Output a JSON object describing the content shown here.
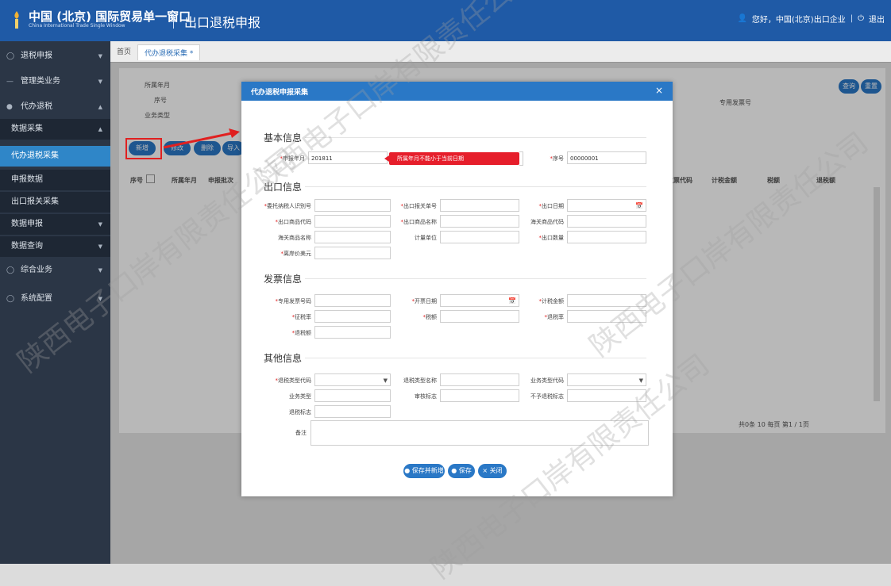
{
  "header": {
    "title": "中国 (北京) 国际贸易单一窗口",
    "subtitle": "China International Trade Single Window",
    "module": "出口退税申报",
    "user": "您好，中国(北京)出口企业",
    "logout": "退出"
  },
  "sidebar": {
    "items": [
      {
        "label": "退税申报"
      },
      {
        "label": "管理类业务"
      },
      {
        "label": "代办退税"
      },
      {
        "label": "数据采集"
      },
      {
        "label": "代办退税采集"
      },
      {
        "label": "申报数据"
      },
      {
        "label": "出口报关采集"
      },
      {
        "label": "数据申报"
      },
      {
        "label": "数据查询"
      },
      {
        "label": "综合业务"
      },
      {
        "label": "系统配置"
      }
    ]
  },
  "tabs": {
    "home": "首页",
    "active": "代办退税采集 *"
  },
  "query": {
    "period_label": "所属年月",
    "seq_label": "序号",
    "biz_label": "业务类型",
    "invoice_label": "专用发票号",
    "search_btn": "查询",
    "reset_btn": "重置"
  },
  "toolbar": {
    "add": "新增",
    "edit": "修改",
    "delete": "删除",
    "more": "导入"
  },
  "table": {
    "columns": [
      "序号",
      "所属年月",
      "申报批次",
      "发票代码",
      "计税金额",
      "税额",
      "退税额"
    ],
    "pagination": "共0条 10 每页 第1 / 1页"
  },
  "modal": {
    "title": "代办退税申报采集",
    "close": "×",
    "sections": {
      "basic": "基本信息",
      "export": "出口信息",
      "invoice": "发票信息",
      "other": "其他信息"
    },
    "fields": {
      "period": {
        "label": "申报年月",
        "value": "201811"
      },
      "seq": {
        "label": "序号",
        "value": "00000001"
      },
      "error_tip": "所属年月不能小于当前日期",
      "taxpayer_id": {
        "label": "委托纳税人识别号"
      },
      "customs_no": {
        "label": "出口报关单号"
      },
      "export_date": {
        "label": "出口日期"
      },
      "goods_code": {
        "label": "出口商品代码"
      },
      "goods_name": {
        "label": "出口商品名称"
      },
      "hs_code": {
        "label": "海关商品代码"
      },
      "hs_name": {
        "label": "海关商品名称"
      },
      "unit": {
        "label": "计量单位"
      },
      "export_qty": {
        "label": "出口数量"
      },
      "fob_price": {
        "label": "离岸价美元"
      },
      "invoice_no": {
        "label": "专用发票号码"
      },
      "invoice_date": {
        "label": "开票日期"
      },
      "tax_amount": {
        "label": "计税金额"
      },
      "tax_rate": {
        "label": "征税率"
      },
      "tax": {
        "label": "税额"
      },
      "refund_rate": {
        "label": "退税率"
      },
      "refund_amount": {
        "label": "退税额"
      },
      "type_code": {
        "label": "退税类型代码"
      },
      "type_name": {
        "label": "退税类型名称"
      },
      "biz_code": {
        "label": "业务类型代码"
      },
      "biz_type": {
        "label": "业务类型"
      },
      "approval": {
        "label": "审核标志"
      },
      "no_refund": {
        "label": "不予退税标志"
      },
      "refund_flag": {
        "label": "退税标志"
      },
      "remark": {
        "label": "备注"
      }
    },
    "buttons": {
      "save_new": "保存并新增",
      "save": "保存",
      "close": "关闭"
    }
  },
  "watermark": "陕西电子口岸有限责任公司"
}
